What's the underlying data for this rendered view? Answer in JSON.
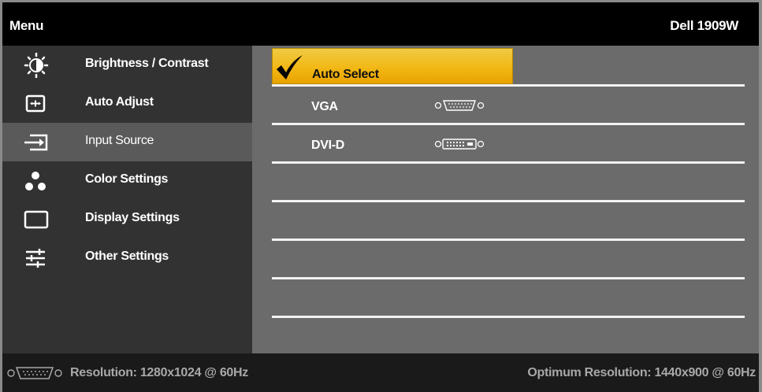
{
  "header": {
    "menu_title": "Menu",
    "model": "Dell 1909W"
  },
  "sidebar": {
    "active_index": 2,
    "items": [
      {
        "label": "Brightness / Contrast",
        "icon": "brightness-icon"
      },
      {
        "label": "Auto Adjust",
        "icon": "auto-adjust-icon"
      },
      {
        "label": "Input Source",
        "icon": "input-source-icon"
      },
      {
        "label": "Color Settings",
        "icon": "color-settings-icon"
      },
      {
        "label": "Display Settings",
        "icon": "display-settings-icon"
      },
      {
        "label": "Other Settings",
        "icon": "other-settings-icon"
      }
    ]
  },
  "input_source": {
    "selected_index": 0,
    "options": [
      {
        "label": "Auto Select",
        "icon": "checkmark-icon"
      },
      {
        "label": "VGA",
        "icon": "vga-connector-icon"
      },
      {
        "label": "DVI-D",
        "icon": "dvi-connector-icon"
      }
    ]
  },
  "status": {
    "connector_icon": "vga-connector-icon",
    "resolution": "Resolution: 1280x1024 @ 60Hz",
    "optimum": "Optimum Resolution: 1440x900 @ 60Hz"
  },
  "colors": {
    "highlight": "#f2b815",
    "sidebar_bg": "#323232",
    "sidebar_active": "#5a5a5a",
    "content_bg": "#6b6b6b"
  }
}
